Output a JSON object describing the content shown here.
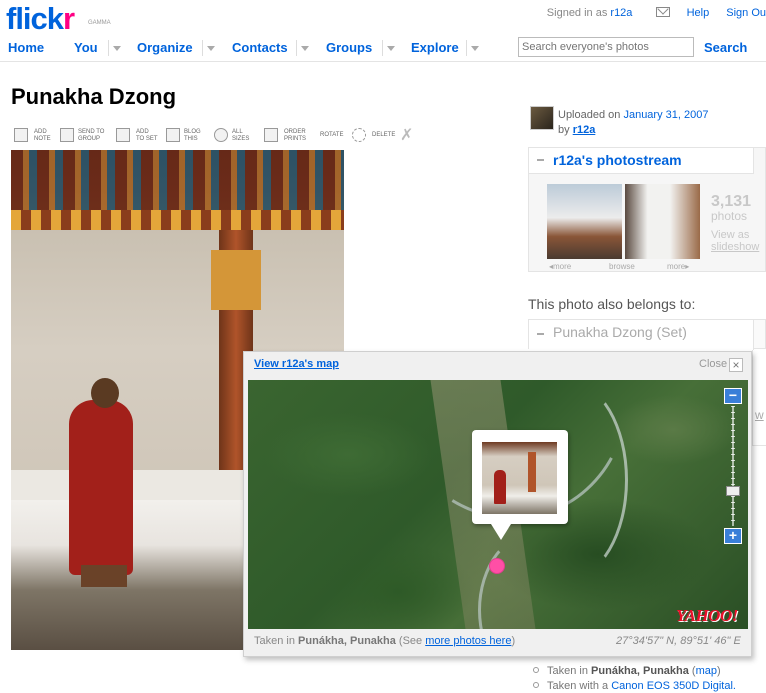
{
  "brand": {
    "logo_part1": "flick",
    "logo_part2": "r",
    "gamma": "GAMMA"
  },
  "topbar": {
    "signed_in_prefix": "Signed in as",
    "username": "r12a",
    "help": "Help",
    "sign_out": "Sign Ou"
  },
  "nav": {
    "home": "Home",
    "you": "You",
    "organize": "Organize",
    "contacts": "Contacts",
    "groups": "Groups",
    "explore": "Explore"
  },
  "search": {
    "placeholder": "Search everyone's photos",
    "button": "Search"
  },
  "photo": {
    "title": "Punakha Dzong"
  },
  "toolbar": {
    "add_note": "ADD\nNOTE",
    "send_to_group": "SEND TO\nGROUP",
    "add_to_set": "ADD\nTO SET",
    "blog_this": "BLOG\nTHIS",
    "all_sizes": "ALL\nSIZES",
    "order_prints": "ORDER\nPRINTS",
    "rotate": "ROTATE",
    "delete": "DELETE"
  },
  "uploader": {
    "uploaded_on": "Uploaded on",
    "date": "January 31, 2007",
    "by": "by",
    "user": "r12a"
  },
  "photostream": {
    "title": "r12a's photostream",
    "count": "3,131",
    "count_label": "photos",
    "view_as": "View as",
    "slideshow": "slideshow",
    "nav_more_left": "◂more",
    "nav_browse": "browse",
    "nav_more_right": "more▸"
  },
  "belongs": {
    "heading": "This photo also belongs to:",
    "set_title": "Punakha Dzong (Set)",
    "partial_link": "w"
  },
  "map_panel": {
    "view_map": "View r12a's map",
    "close": "Close",
    "close_icon": "×",
    "taken_in": "Taken in",
    "place": "Punákha, Punakha",
    "see_prefix": "(See",
    "more_photos": "more photos here",
    "see_suffix": ")",
    "coordinates": "27°34'57\" N, 89°51' 46\" E",
    "provider": "YAHOO!",
    "zoom_in": "+",
    "zoom_out": "−"
  },
  "details": {
    "taken_in_label": "Taken in",
    "taken_in_place": "Punákha, Punakha",
    "map_label": "map",
    "camera_label": "Taken with a",
    "camera": "Canon EOS 350D Digital."
  }
}
